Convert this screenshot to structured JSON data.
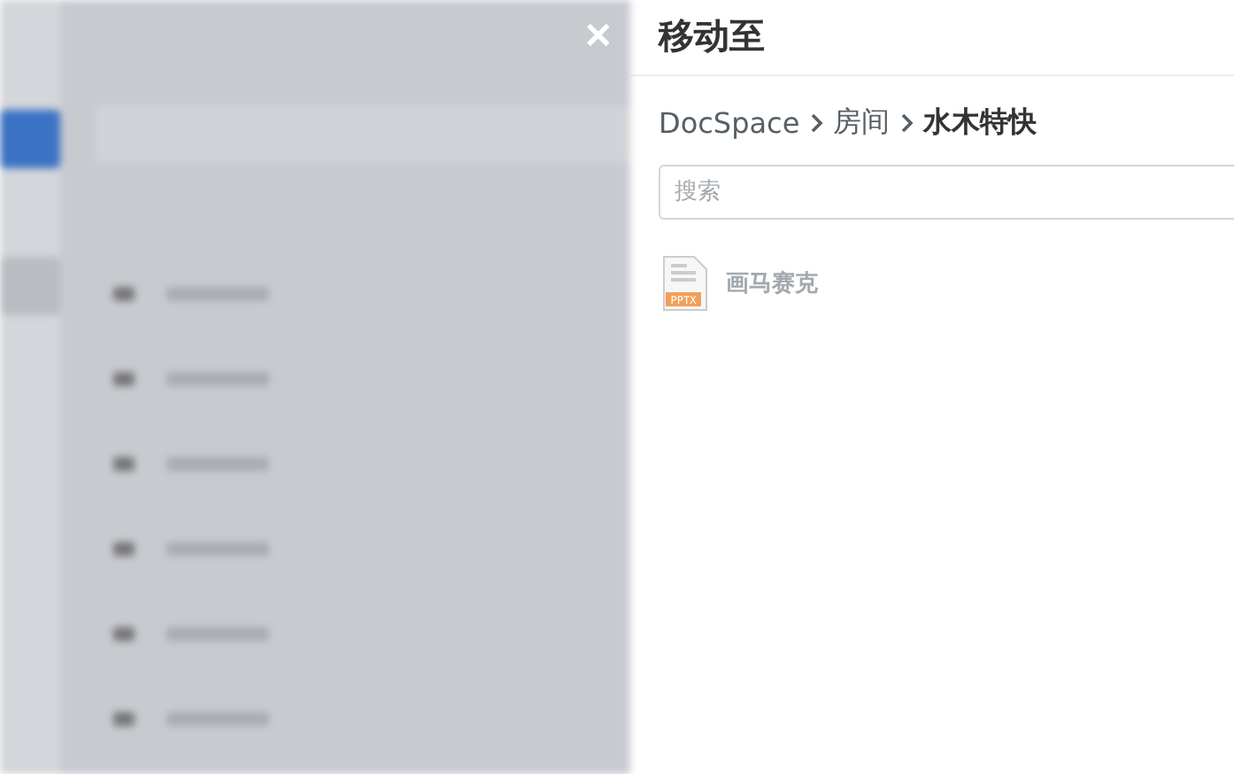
{
  "close": "✕",
  "panel": {
    "title": "移动至",
    "breadcrumbs": [
      {
        "label": "DocSpace",
        "current": false
      },
      {
        "label": "房间",
        "current": false
      },
      {
        "label": "水木特快",
        "current": true
      }
    ],
    "search": {
      "placeholder": "搜索"
    },
    "files": [
      {
        "name": "画马赛克",
        "badge": "PPTX"
      }
    ]
  }
}
